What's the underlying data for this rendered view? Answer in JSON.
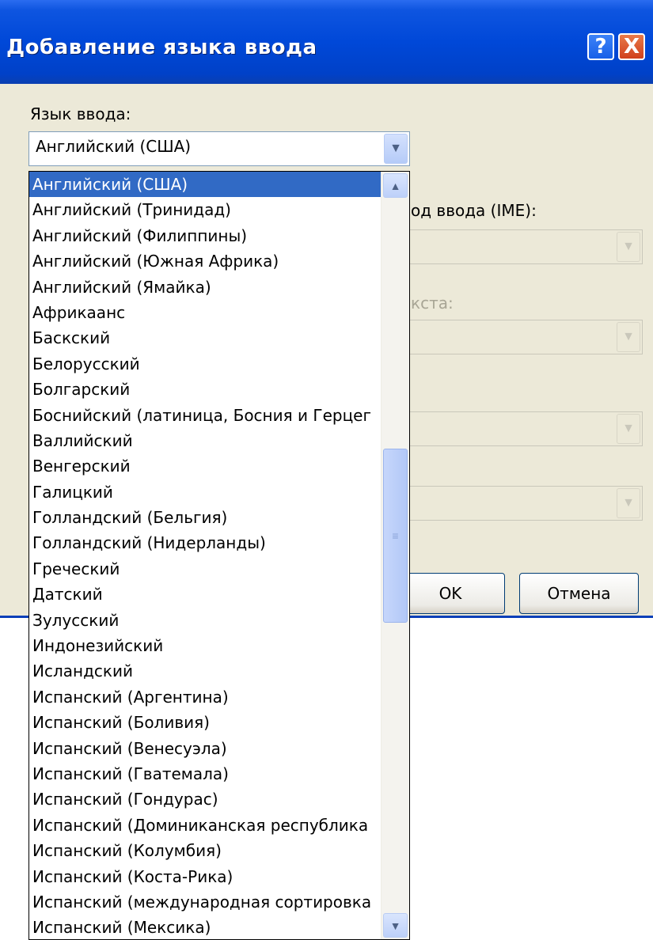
{
  "window": {
    "title": "Добавление языка ввода",
    "help_icon": "?",
    "close_icon": "X"
  },
  "labels": {
    "input_language": "Язык ввода:",
    "ime_partial": "од ввода (IME):",
    "text_partial": "кста:"
  },
  "language_combo": {
    "value": "Английский (США)",
    "icon": "chevron-down-icon"
  },
  "buttons": {
    "ok": "OK",
    "cancel": "Отмена"
  },
  "language_list": {
    "selected_index": 0,
    "items": [
      "Английский (США)",
      "Английский (Тринидад)",
      "Английский (Филиппины)",
      "Английский (Южная Африка)",
      "Английский (Ямайка)",
      "Африкаанс",
      "Баскский",
      "Белорусский",
      "Болгарский",
      "Боснийский (латиница, Босния и Герцег",
      "Валлийский",
      "Венгерский",
      "Галицкий",
      "Голландский (Бельгия)",
      "Голландский (Нидерланды)",
      "Греческий",
      "Датский",
      "Зулусский",
      "Индонезийский",
      "Исландский",
      "Испанский (Аргентина)",
      "Испанский (Боливия)",
      "Испанский (Венесуэла)",
      "Испанский (Гватемала)",
      "Испанский (Гондурас)",
      "Испанский (Доминиканская республика",
      "Испанский (Колумбия)",
      "Испанский (Коста-Рика)",
      "Испанский (международная сортировка",
      "Испанский (Мексика)"
    ]
  },
  "colors": {
    "title_bar": "#0048d8",
    "selection": "#316ac5",
    "dialog_bg": "#ece9d8"
  }
}
